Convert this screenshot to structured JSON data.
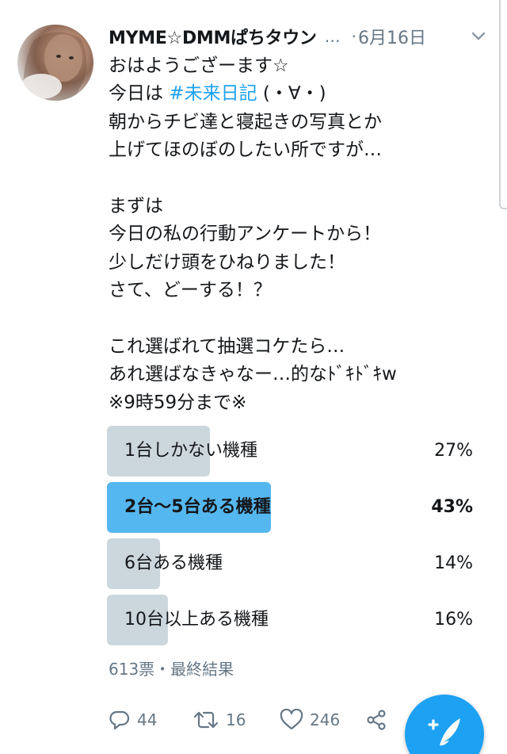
{
  "tweet": {
    "author_name": "MYME☆DMMぱちタウン",
    "name_ellipsis": "…",
    "separator": "·",
    "date": "6月16日",
    "text_lines": [
      "おはようござーます☆",
      "今日は",
      "#未来日記",
      " (・∀・)",
      "朝からチビ達と寝起きの写真とか",
      "上げてほのぼのしたい所ですが…",
      "",
      "まずは",
      "今日の私の行動アンケートから！",
      "少しだけ頭をひねりました！",
      "さて、どーする！？",
      "",
      "これ選ばれて抽選コケたら…",
      "あれ選ばなきゃなー…的なﾄﾞｷﾄﾞｷw",
      "※9時59分まで※"
    ]
  },
  "poll": {
    "options": [
      {
        "label": "1台しかない機種",
        "percent_text": "27%",
        "fraction": 0.27,
        "winner": false
      },
      {
        "label": "2台〜5台ある機種",
        "percent_text": "43%",
        "fraction": 0.43,
        "winner": true
      },
      {
        "label": "6台ある機種",
        "percent_text": "14%",
        "fraction": 0.14,
        "winner": false
      },
      {
        "label": "10台以上ある機種",
        "percent_text": "16%",
        "fraction": 0.16,
        "winner": false
      }
    ],
    "meta": "613票・最終結果"
  },
  "actions": {
    "reply_count": "44",
    "retweet_count": "16",
    "like_count": "246"
  },
  "icons": {
    "caret": "chevron-down-icon",
    "reply": "reply-icon",
    "retweet": "retweet-icon",
    "like": "heart-icon",
    "share": "share-icon",
    "compose": "compose-tweet-icon"
  },
  "colors": {
    "accent": "#1da1f2",
    "poll_winner": "#55b7ef",
    "poll_other": "#ccd6dd",
    "muted": "#657786"
  }
}
